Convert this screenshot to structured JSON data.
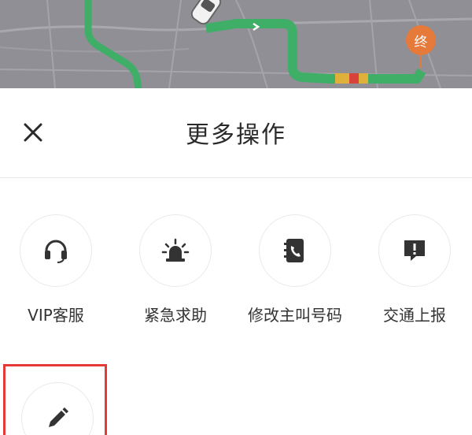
{
  "map": {
    "destination_label": "终",
    "route_color": "#3fae67"
  },
  "sheet": {
    "title": "更多操作",
    "close_icon": "close-icon",
    "actions": [
      {
        "label": "VIP客服",
        "icon": "headset-icon"
      },
      {
        "label": "紧急求助",
        "icon": "alarm-icon"
      },
      {
        "label": "修改主叫号码",
        "icon": "phonebook-icon"
      },
      {
        "label": "交通上报",
        "icon": "report-icon"
      }
    ],
    "highlighted_action": {
      "icon": "pencil-icon",
      "highlight_color": "#e53935"
    }
  }
}
